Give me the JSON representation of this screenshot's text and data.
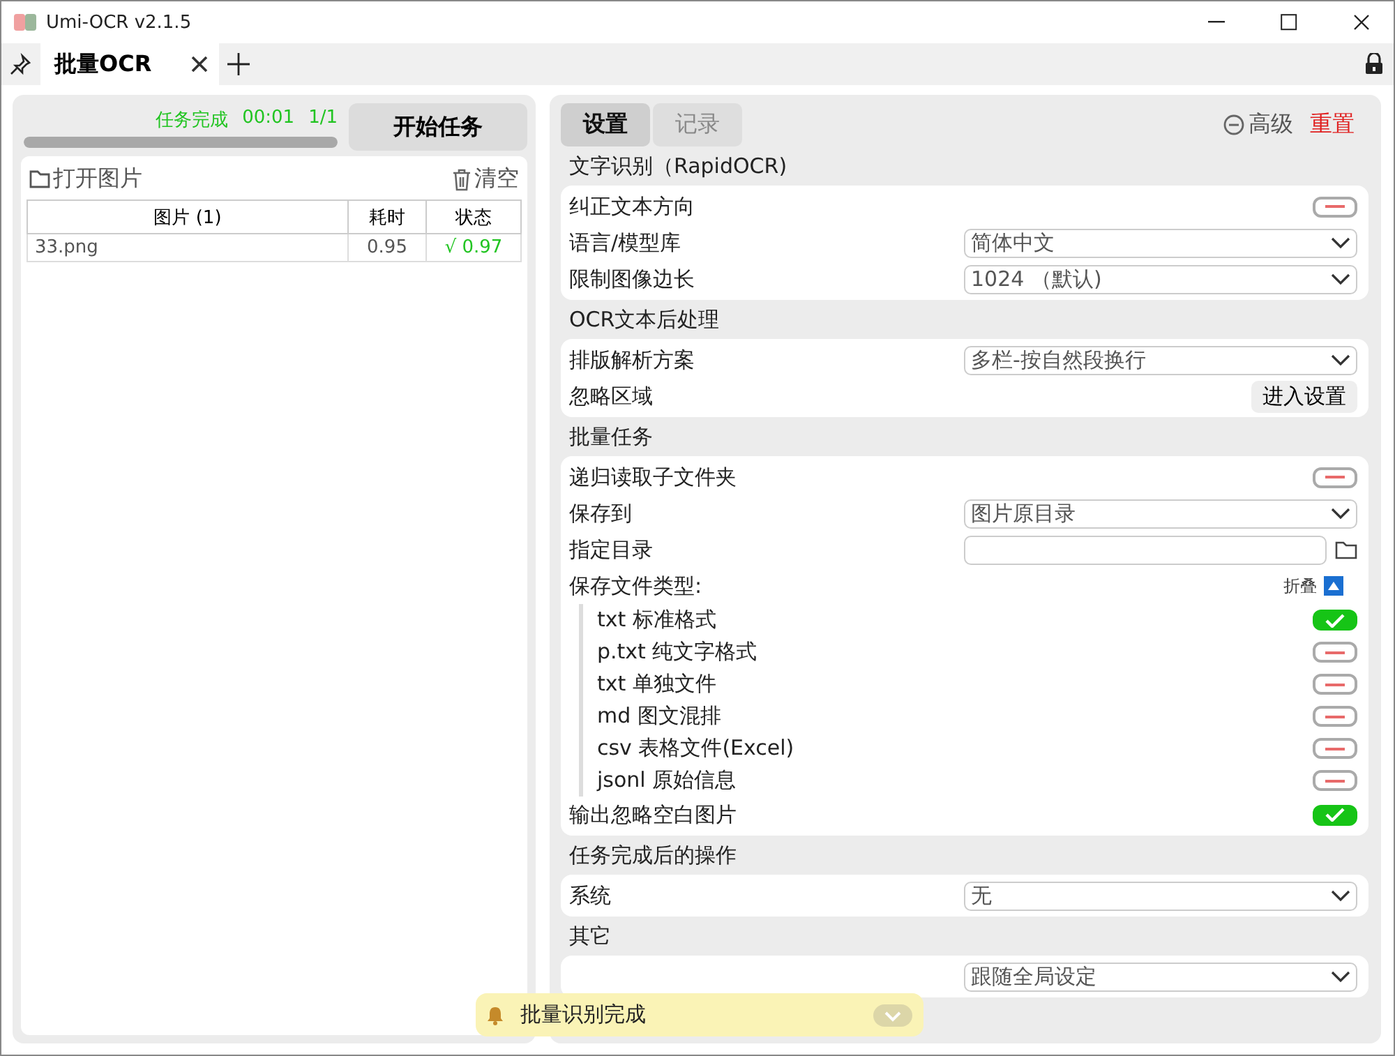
{
  "window": {
    "title": "Umi-OCR v2.1.5"
  },
  "tabs": [
    {
      "label": "批量OCR",
      "selected": true
    }
  ],
  "task": {
    "status": "任务完成",
    "elapsed": "00:01",
    "count": "1/1",
    "level": 1.0,
    "start_button": "开始任务"
  },
  "files": {
    "open_button": "打开图片",
    "clear_button": "清空",
    "columns": [
      "图片 (1)",
      "耗时",
      "状态"
    ],
    "rows": [
      {
        "name": "33.png",
        "time": "0.95",
        "status": "√ 0.97"
      }
    ]
  },
  "settings": {
    "tabs": [
      {
        "label": "设置",
        "selected": true
      },
      {
        "label": "记录",
        "selected": false
      }
    ],
    "advanced": "高级",
    "reset": "重置",
    "groups": [
      {
        "title": "文字识别（RapidOCR)",
        "rows": [
          {
            "kind": "switch",
            "label": "纠正文本方向",
            "on": false
          },
          {
            "kind": "select",
            "label": "语言/模型库",
            "value": "简体中文"
          },
          {
            "kind": "select",
            "label": "限制图像边长",
            "value": "1024 （默认)"
          }
        ]
      },
      {
        "title": "OCR文本后处理",
        "rows": [
          {
            "kind": "select",
            "label": "排版解析方案",
            "value": "多栏-按自然段换行"
          },
          {
            "kind": "button",
            "label": "忽略区域",
            "button": "进入设置"
          }
        ]
      },
      {
        "title": "批量任务",
        "rows": [
          {
            "kind": "switch",
            "label": "递归读取子文件夹",
            "on": false
          },
          {
            "kind": "select",
            "label": "保存到",
            "value": "图片原目录"
          },
          {
            "kind": "path",
            "label": "指定目录"
          },
          {
            "kind": "filetypes",
            "label": "保存文件类型:",
            "fold": "折叠",
            "items": [
              {
                "label": "txt 标准格式",
                "on": true
              },
              {
                "label": "p.txt 纯文字格式",
                "on": false
              },
              {
                "label": "txt 单独文件",
                "on": false
              },
              {
                "label": "md 图文混排",
                "on": false
              },
              {
                "label": "csv 表格文件(Excel)",
                "on": false
              },
              {
                "label": "jsonl 原始信息",
                "on": false
              }
            ]
          },
          {
            "kind": "switch",
            "label": "输出忽略空白图片",
            "on": true
          }
        ]
      },
      {
        "title": "任务完成后的操作",
        "rows": [
          {
            "kind": "select",
            "label": "系统",
            "value": "无"
          }
        ]
      },
      {
        "title": "其它",
        "rows": [
          {
            "kind": "select",
            "value": "跟随全局设定"
          }
        ]
      }
    ]
  },
  "toast": {
    "message": "批量识别完成"
  }
}
